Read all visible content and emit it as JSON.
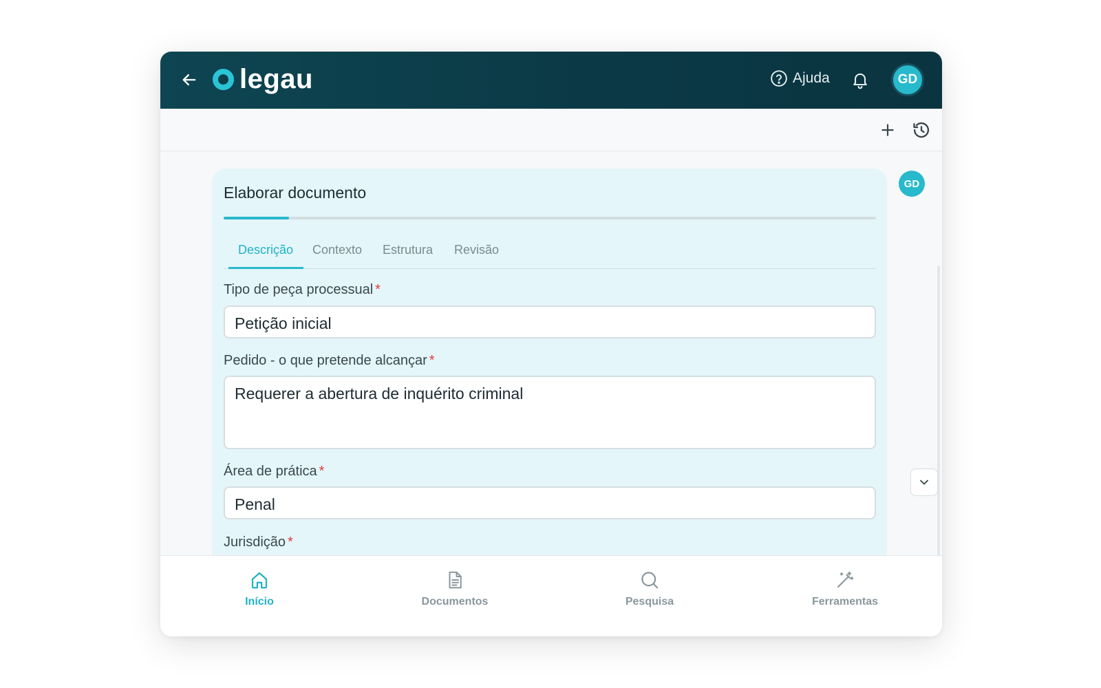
{
  "app": {
    "logo_text": "legau",
    "help_label": "Ajuda",
    "avatar_initials": "GD"
  },
  "card": {
    "title": "Elaborar documento",
    "progress": 0.1,
    "tabs": [
      {
        "label": "Descrição",
        "active": true
      },
      {
        "label": "Contexto",
        "active": false
      },
      {
        "label": "Estrutura",
        "active": false
      },
      {
        "label": "Revisão",
        "active": false
      }
    ]
  },
  "form": {
    "required_mark": "*",
    "fields": [
      {
        "label": "Tipo de peça processual",
        "value": "Petição inicial"
      },
      {
        "label": "Pedido - o que pretende alcançar",
        "value": "Requerer a abertura de inquérito criminal"
      },
      {
        "label": "Área de prática",
        "value": "Penal"
      },
      {
        "label": "Jurisdição",
        "value": ""
      }
    ]
  },
  "nav": [
    {
      "label": "Início",
      "icon": "home-icon",
      "active": true
    },
    {
      "label": "Documentos",
      "icon": "document-icon",
      "active": false
    },
    {
      "label": "Pesquisa",
      "icon": "search-icon",
      "active": false
    },
    {
      "label": "Ferramentas",
      "icon": "magic-wand-icon",
      "active": false
    }
  ],
  "colors": {
    "accent": "#27b9cc",
    "header": "#0b3a46",
    "card_bg": "#e4f6fa",
    "required": "#e23b3b"
  }
}
